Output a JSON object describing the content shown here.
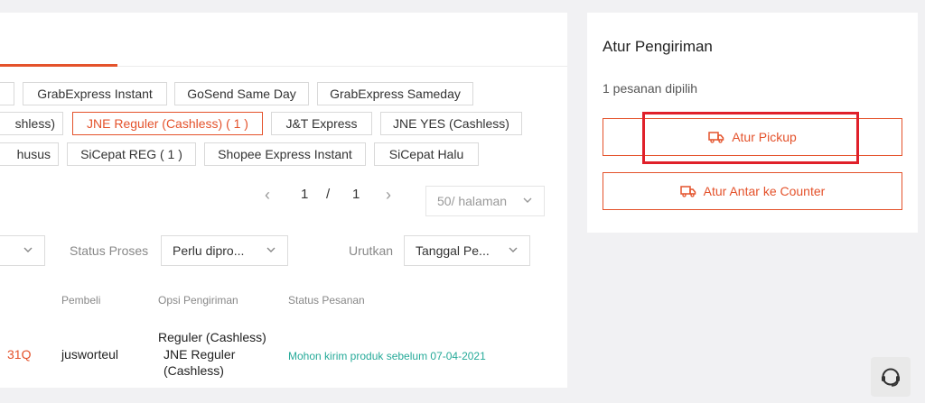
{
  "shipping_chips": [
    {
      "label": "GrabExpress Instant"
    },
    {
      "label": "GoSend Same Day"
    },
    {
      "label": "GrabExpress Sameday"
    },
    {
      "label": "shless)"
    },
    {
      "label": "JNE Reguler (Cashless) ( 1 )"
    },
    {
      "label": "J&T Express"
    },
    {
      "label": "JNE YES (Cashless)"
    },
    {
      "label": "husus"
    },
    {
      "label": "SiCepat REG ( 1 )"
    },
    {
      "label": "Shopee Express Instant"
    },
    {
      "label": "SiCepat Halu"
    }
  ],
  "pagination": {
    "current": "1",
    "separator": "/",
    "total": "1",
    "per_page": "50/ halaman"
  },
  "filters": {
    "status_label": "Status Proses",
    "status_value": "Perlu dipro...",
    "sort_label": "Urutkan",
    "sort_value": "Tanggal Pe..."
  },
  "table": {
    "headers": [
      "Pembeli",
      "Opsi Pengiriman",
      "Status Pesanan"
    ],
    "row": {
      "order_id_fragment": "31Q",
      "buyer": "jusworteul",
      "shipping_line1": "Reguler (Cashless)",
      "shipping_line2": "JNE Reguler",
      "shipping_line3": "(Cashless)",
      "status": "Mohon kirim produk sebelum 07-04-2021"
    }
  },
  "side_panel": {
    "title": "Atur Pengiriman",
    "selected_count": "1 pesanan dipilih",
    "pickup_label": "Atur Pickup",
    "counter_label": "Atur Antar ke Counter"
  },
  "colors": {
    "accent": "#e4522b",
    "highlight": "#e0202a",
    "status_green": "#26aa99"
  }
}
